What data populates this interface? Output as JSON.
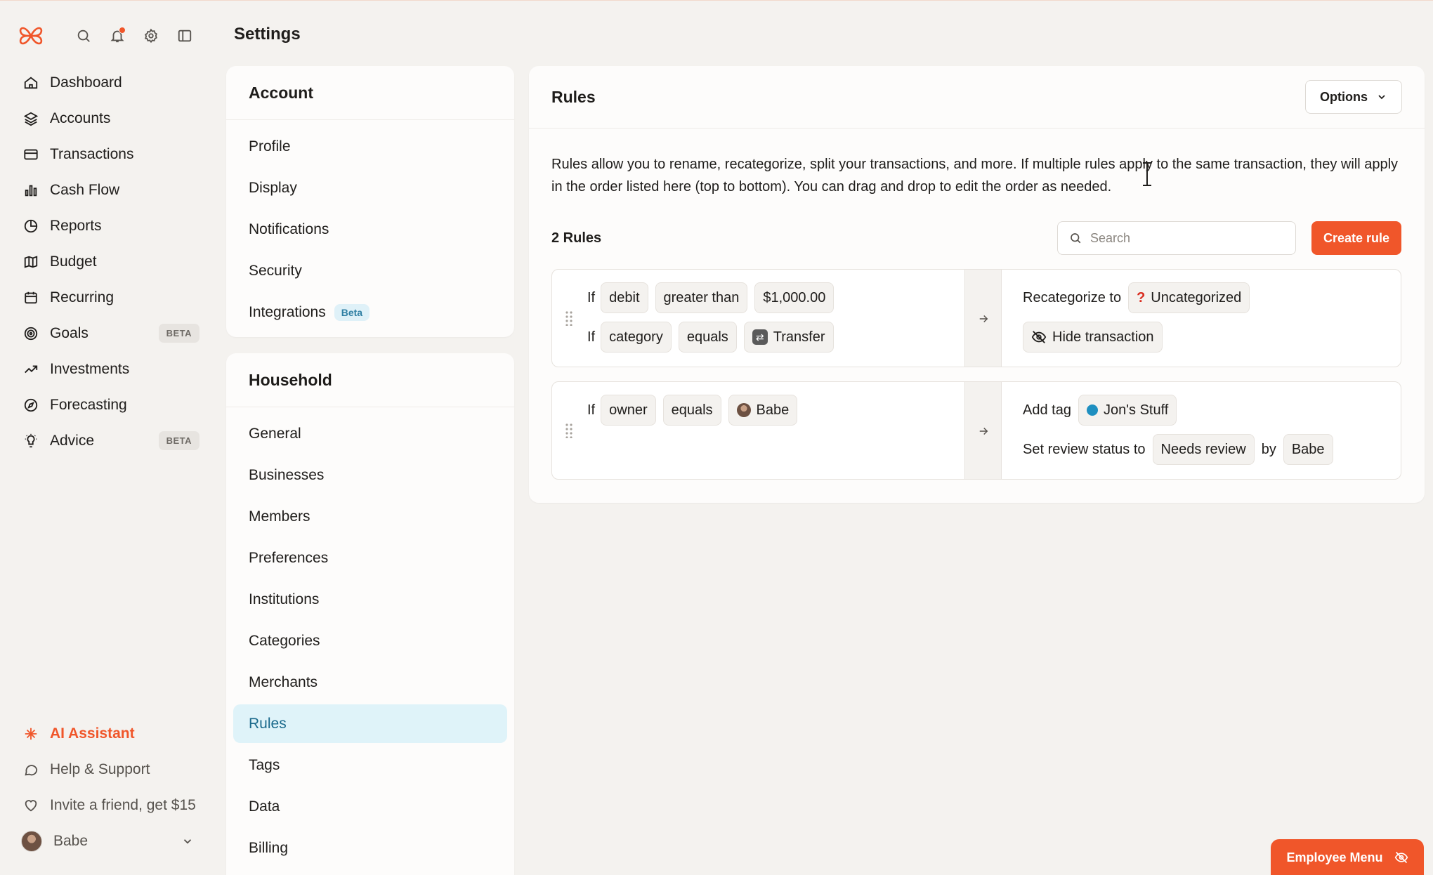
{
  "page_title": "Settings",
  "colors": {
    "accent": "#f0562a",
    "active_bg": "#dff3f9",
    "tag_dot": "#1e8fc0",
    "notification_dot": "#f0562a"
  },
  "sidebar": {
    "top_icons": [
      "search-icon",
      "bell-icon",
      "gear-icon",
      "sidebar-toggle-icon"
    ],
    "items": [
      {
        "label": "Dashboard",
        "icon": "home-icon"
      },
      {
        "label": "Accounts",
        "icon": "layers-icon"
      },
      {
        "label": "Transactions",
        "icon": "credit-card-icon"
      },
      {
        "label": "Cash Flow",
        "icon": "bar-chart-icon"
      },
      {
        "label": "Reports",
        "icon": "pie-chart-icon"
      },
      {
        "label": "Budget",
        "icon": "map-icon"
      },
      {
        "label": "Recurring",
        "icon": "calendar-icon"
      },
      {
        "label": "Goals",
        "icon": "target-icon",
        "badge": "BETA"
      },
      {
        "label": "Investments",
        "icon": "trend-up-icon"
      },
      {
        "label": "Forecasting",
        "icon": "compass-icon"
      },
      {
        "label": "Advice",
        "icon": "lightbulb-icon",
        "badge": "BETA"
      }
    ],
    "bottom": {
      "ai_assistant": "AI Assistant",
      "help": "Help & Support",
      "invite": "Invite a friend, get $15",
      "user": "Babe"
    }
  },
  "account_section": {
    "title": "Account",
    "items": [
      "Profile",
      "Display",
      "Notifications",
      "Security",
      "Integrations"
    ],
    "integrations_badge": "Beta"
  },
  "household_section": {
    "title": "Household",
    "items": [
      "General",
      "Businesses",
      "Members",
      "Preferences",
      "Institutions",
      "Categories",
      "Merchants",
      "Rules",
      "Tags",
      "Data",
      "Billing"
    ],
    "active": "Rules"
  },
  "rules_panel": {
    "title": "Rules",
    "options_label": "Options",
    "description": "Rules allow you to rename, recategorize, split your transactions, and more. If multiple rules apply to the same transaction, they will apply in the order listed here (top to bottom). You can drag and drop to edit the order as needed.",
    "count_label": "2 Rules",
    "search_placeholder": "Search",
    "create_label": "Create rule",
    "rules": [
      {
        "conditions": [
          {
            "kw": "If",
            "field": "debit",
            "op": "greater than",
            "value": "$1,000.00"
          },
          {
            "kw": "If",
            "field": "category",
            "op": "equals",
            "value": "Transfer"
          }
        ],
        "actions": {
          "recategorize_label": "Recategorize to",
          "recategorize_value": "Uncategorized",
          "hide_label": "Hide transaction"
        }
      },
      {
        "conditions": [
          {
            "kw": "If",
            "field": "owner",
            "op": "equals",
            "value": "Babe"
          }
        ],
        "actions": {
          "tag_label": "Add tag",
          "tag_value": "Jon's Stuff",
          "review_label": "Set review status to",
          "review_value": "Needs review",
          "by_label": "by",
          "by_value": "Babe"
        }
      }
    ]
  },
  "employee_menu": "Employee Menu"
}
